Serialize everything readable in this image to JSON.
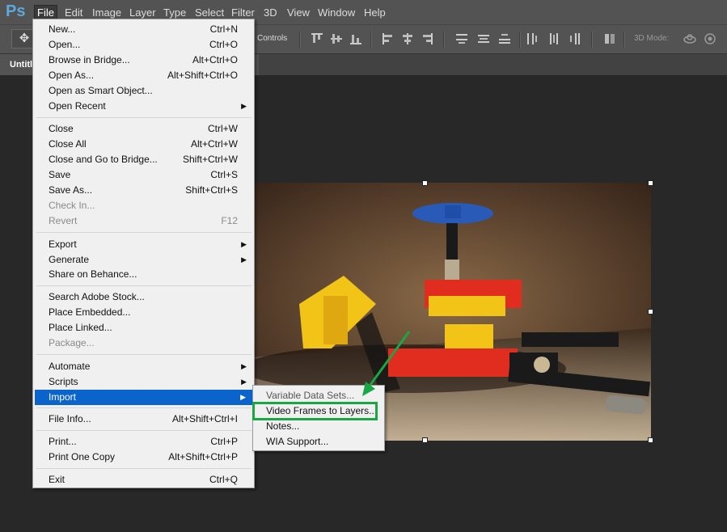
{
  "app": {
    "logo": "Ps"
  },
  "menubar": {
    "items": [
      "File",
      "Edit",
      "Image",
      "Layer",
      "Type",
      "Select",
      "Filter",
      "3D",
      "View",
      "Window",
      "Help"
    ]
  },
  "options_bar": {
    "controls_label": "Controls",
    "mode_3d_label": "3D Mode:"
  },
  "document": {
    "tab_title": "Untitl"
  },
  "file_menu": {
    "items": [
      {
        "label": "New...",
        "shortcut": "Ctrl+N"
      },
      {
        "label": "Open...",
        "shortcut": "Ctrl+O"
      },
      {
        "label": "Browse in Bridge...",
        "shortcut": "Alt+Ctrl+O"
      },
      {
        "label": "Open As...",
        "shortcut": "Alt+Shift+Ctrl+O"
      },
      {
        "label": "Open as Smart Object..."
      },
      {
        "label": "Open Recent",
        "submenu": true
      },
      {
        "label": "Close",
        "shortcut": "Ctrl+W"
      },
      {
        "label": "Close All",
        "shortcut": "Alt+Ctrl+W"
      },
      {
        "label": "Close and Go to Bridge...",
        "shortcut": "Shift+Ctrl+W"
      },
      {
        "label": "Save",
        "shortcut": "Ctrl+S"
      },
      {
        "label": "Save As...",
        "shortcut": "Shift+Ctrl+S"
      },
      {
        "label": "Check In...",
        "disabled": true
      },
      {
        "label": "Revert",
        "shortcut": "F12",
        "disabled": true
      },
      {
        "label": "Export",
        "submenu": true
      },
      {
        "label": "Generate",
        "submenu": true
      },
      {
        "label": "Share on Behance..."
      },
      {
        "label": "Search Adobe Stock..."
      },
      {
        "label": "Place Embedded..."
      },
      {
        "label": "Place Linked..."
      },
      {
        "label": "Package...",
        "disabled": true
      },
      {
        "label": "Automate",
        "submenu": true
      },
      {
        "label": "Scripts",
        "submenu": true
      },
      {
        "label": "Import",
        "submenu": true,
        "highlighted": true
      },
      {
        "label": "File Info...",
        "shortcut": "Alt+Shift+Ctrl+I"
      },
      {
        "label": "Print...",
        "shortcut": "Ctrl+P"
      },
      {
        "label": "Print One Copy",
        "shortcut": "Alt+Shift+Ctrl+P"
      },
      {
        "label": "Exit",
        "shortcut": "Ctrl+Q"
      }
    ]
  },
  "import_submenu": {
    "items": [
      {
        "label": "Variable Data Sets..."
      },
      {
        "label": "Video Frames to Layers...",
        "annotated": true
      },
      {
        "label": "Notes..."
      },
      {
        "label": "WIA Support..."
      }
    ]
  },
  "colors": {
    "highlight": "#0a64cc",
    "annotation": "#1aa644",
    "menubar_bg": "#535353",
    "canvas_bg": "#282828"
  }
}
